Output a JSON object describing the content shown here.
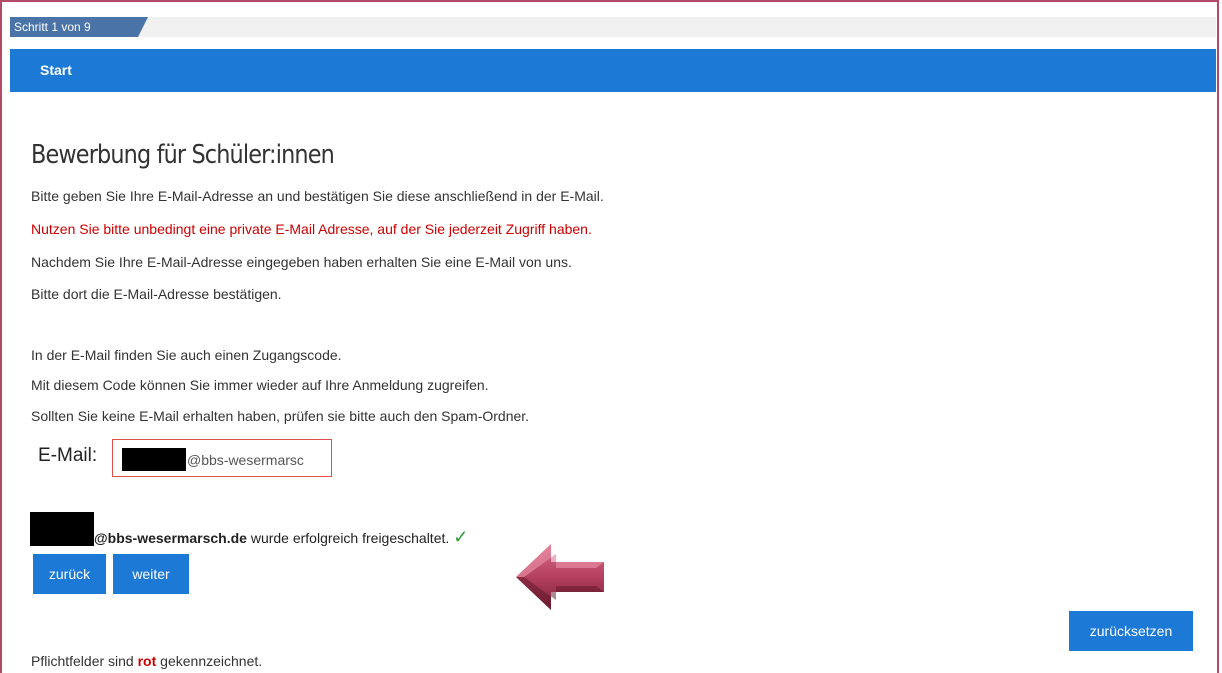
{
  "progress": {
    "step_label": "Schritt 1 von 9"
  },
  "header": {
    "section_title": "Start"
  },
  "main": {
    "title": "Bewerbung für Schüler:innen",
    "lines": [
      "Bitte geben Sie Ihre E-Mail-Adresse an und bestätigen Sie diese anschließend in der E-Mail.",
      "Nutzen Sie bitte unbedingt eine private E-Mail Adresse, auf der Sie jederzeit Zugriff haben.",
      "Nachdem Sie Ihre E-Mail-Adresse eingegeben haben erhalten Sie eine E-Mail von uns.",
      "Bitte dort die E-Mail-Adresse bestätigen.",
      "In der E-Mail finden Sie auch einen Zugangscode.",
      "Mit diesem Code können Sie immer wieder auf Ihre Anmeldung zugreifen.",
      "Sollten Sie keine E-Mail erhalten haben, prüfen sie bitte auch den Spam-Ordner."
    ],
    "email": {
      "label": "E-Mail:",
      "value_visible": "@bbs-wesermarsc"
    },
    "confirmation": {
      "address_domain": "@bbs-wesermarsch.de",
      "message": " wurde erfolgreich freigeschaltet.",
      "check": "✓"
    }
  },
  "buttons": {
    "back": "zurück",
    "next": "weiter",
    "reset": "zurücksetzen"
  },
  "footer": {
    "prefix": "Pflichtfelder sind ",
    "highlight": "rot",
    "suffix": " gekennzeichnet."
  },
  "colors": {
    "accent": "#1c7ad6",
    "required": "#cc0000",
    "success": "#2e9b2e",
    "arrow": "#b5405f"
  },
  "icons": {
    "confirmation": "checkmark-icon",
    "annotation": "left-arrow-icon"
  }
}
